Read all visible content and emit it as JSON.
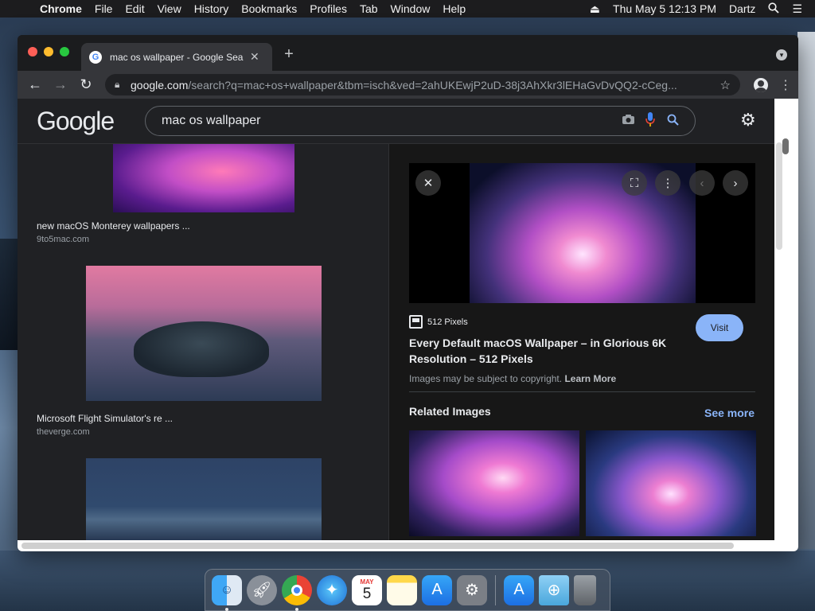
{
  "menubar": {
    "app": "Chrome",
    "items": [
      "File",
      "Edit",
      "View",
      "History",
      "Bookmarks",
      "Profiles",
      "Tab",
      "Window",
      "Help"
    ],
    "clock": "Thu May 5  12:13 PM",
    "user": "Dartz"
  },
  "browser": {
    "tab_title": "mac os wallpaper - Google Sea",
    "url_host": "google.com",
    "url_path": "/search?q=mac+os+wallpaper&tbm=isch&ved=2ahUKEwjP2uD-38j3AhXkr3lEHaGvDvQQ2-cCeg..."
  },
  "google": {
    "logo": "Google",
    "query": "mac os wallpaper"
  },
  "results": [
    {
      "title": "new macOS Monterey wallpapers ...",
      "source": "9to5mac.com"
    },
    {
      "title": "Microsoft Flight Simulator's re ...",
      "source": "theverge.com"
    }
  ],
  "panel": {
    "site": "512 Pixels",
    "title": "Every Default macOS Wallpaper – in Glorious 6K Resolution – 512 Pixels",
    "visit": "Visit",
    "copyright": "Images may be subject to copyright.",
    "learn_more": "Learn More",
    "related": "Related Images",
    "see_more": "See more"
  },
  "dock": {
    "apps": [
      "finder-icon",
      "launchpad-icon",
      "chrome-icon",
      "safari-icon",
      "calendar-icon",
      "notes-icon",
      "app-store-icon",
      "system-preferences-icon",
      "app-store-downloads-icon",
      "downloads-folder-icon",
      "trash-icon"
    ],
    "calendar_month": "MAY",
    "calendar_day": "5"
  }
}
